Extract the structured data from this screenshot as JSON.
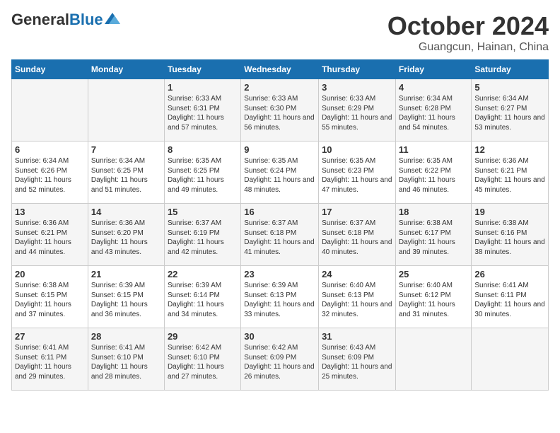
{
  "logo": {
    "general": "General",
    "blue": "Blue"
  },
  "title": "October 2024",
  "location": "Guangcun, Hainan, China",
  "days_of_week": [
    "Sunday",
    "Monday",
    "Tuesday",
    "Wednesday",
    "Thursday",
    "Friday",
    "Saturday"
  ],
  "weeks": [
    [
      {
        "day": "",
        "info": ""
      },
      {
        "day": "",
        "info": ""
      },
      {
        "day": "1",
        "info": "Sunrise: 6:33 AM\nSunset: 6:31 PM\nDaylight: 11 hours and 57 minutes."
      },
      {
        "day": "2",
        "info": "Sunrise: 6:33 AM\nSunset: 6:30 PM\nDaylight: 11 hours and 56 minutes."
      },
      {
        "day": "3",
        "info": "Sunrise: 6:33 AM\nSunset: 6:29 PM\nDaylight: 11 hours and 55 minutes."
      },
      {
        "day": "4",
        "info": "Sunrise: 6:34 AM\nSunset: 6:28 PM\nDaylight: 11 hours and 54 minutes."
      },
      {
        "day": "5",
        "info": "Sunrise: 6:34 AM\nSunset: 6:27 PM\nDaylight: 11 hours and 53 minutes."
      }
    ],
    [
      {
        "day": "6",
        "info": "Sunrise: 6:34 AM\nSunset: 6:26 PM\nDaylight: 11 hours and 52 minutes."
      },
      {
        "day": "7",
        "info": "Sunrise: 6:34 AM\nSunset: 6:25 PM\nDaylight: 11 hours and 51 minutes."
      },
      {
        "day": "8",
        "info": "Sunrise: 6:35 AM\nSunset: 6:25 PM\nDaylight: 11 hours and 49 minutes."
      },
      {
        "day": "9",
        "info": "Sunrise: 6:35 AM\nSunset: 6:24 PM\nDaylight: 11 hours and 48 minutes."
      },
      {
        "day": "10",
        "info": "Sunrise: 6:35 AM\nSunset: 6:23 PM\nDaylight: 11 hours and 47 minutes."
      },
      {
        "day": "11",
        "info": "Sunrise: 6:35 AM\nSunset: 6:22 PM\nDaylight: 11 hours and 46 minutes."
      },
      {
        "day": "12",
        "info": "Sunrise: 6:36 AM\nSunset: 6:21 PM\nDaylight: 11 hours and 45 minutes."
      }
    ],
    [
      {
        "day": "13",
        "info": "Sunrise: 6:36 AM\nSunset: 6:21 PM\nDaylight: 11 hours and 44 minutes."
      },
      {
        "day": "14",
        "info": "Sunrise: 6:36 AM\nSunset: 6:20 PM\nDaylight: 11 hours and 43 minutes."
      },
      {
        "day": "15",
        "info": "Sunrise: 6:37 AM\nSunset: 6:19 PM\nDaylight: 11 hours and 42 minutes."
      },
      {
        "day": "16",
        "info": "Sunrise: 6:37 AM\nSunset: 6:18 PM\nDaylight: 11 hours and 41 minutes."
      },
      {
        "day": "17",
        "info": "Sunrise: 6:37 AM\nSunset: 6:18 PM\nDaylight: 11 hours and 40 minutes."
      },
      {
        "day": "18",
        "info": "Sunrise: 6:38 AM\nSunset: 6:17 PM\nDaylight: 11 hours and 39 minutes."
      },
      {
        "day": "19",
        "info": "Sunrise: 6:38 AM\nSunset: 6:16 PM\nDaylight: 11 hours and 38 minutes."
      }
    ],
    [
      {
        "day": "20",
        "info": "Sunrise: 6:38 AM\nSunset: 6:15 PM\nDaylight: 11 hours and 37 minutes."
      },
      {
        "day": "21",
        "info": "Sunrise: 6:39 AM\nSunset: 6:15 PM\nDaylight: 11 hours and 36 minutes."
      },
      {
        "day": "22",
        "info": "Sunrise: 6:39 AM\nSunset: 6:14 PM\nDaylight: 11 hours and 34 minutes."
      },
      {
        "day": "23",
        "info": "Sunrise: 6:39 AM\nSunset: 6:13 PM\nDaylight: 11 hours and 33 minutes."
      },
      {
        "day": "24",
        "info": "Sunrise: 6:40 AM\nSunset: 6:13 PM\nDaylight: 11 hours and 32 minutes."
      },
      {
        "day": "25",
        "info": "Sunrise: 6:40 AM\nSunset: 6:12 PM\nDaylight: 11 hours and 31 minutes."
      },
      {
        "day": "26",
        "info": "Sunrise: 6:41 AM\nSunset: 6:11 PM\nDaylight: 11 hours and 30 minutes."
      }
    ],
    [
      {
        "day": "27",
        "info": "Sunrise: 6:41 AM\nSunset: 6:11 PM\nDaylight: 11 hours and 29 minutes."
      },
      {
        "day": "28",
        "info": "Sunrise: 6:41 AM\nSunset: 6:10 PM\nDaylight: 11 hours and 28 minutes."
      },
      {
        "day": "29",
        "info": "Sunrise: 6:42 AM\nSunset: 6:10 PM\nDaylight: 11 hours and 27 minutes."
      },
      {
        "day": "30",
        "info": "Sunrise: 6:42 AM\nSunset: 6:09 PM\nDaylight: 11 hours and 26 minutes."
      },
      {
        "day": "31",
        "info": "Sunrise: 6:43 AM\nSunset: 6:09 PM\nDaylight: 11 hours and 25 minutes."
      },
      {
        "day": "",
        "info": ""
      },
      {
        "day": "",
        "info": ""
      }
    ]
  ]
}
